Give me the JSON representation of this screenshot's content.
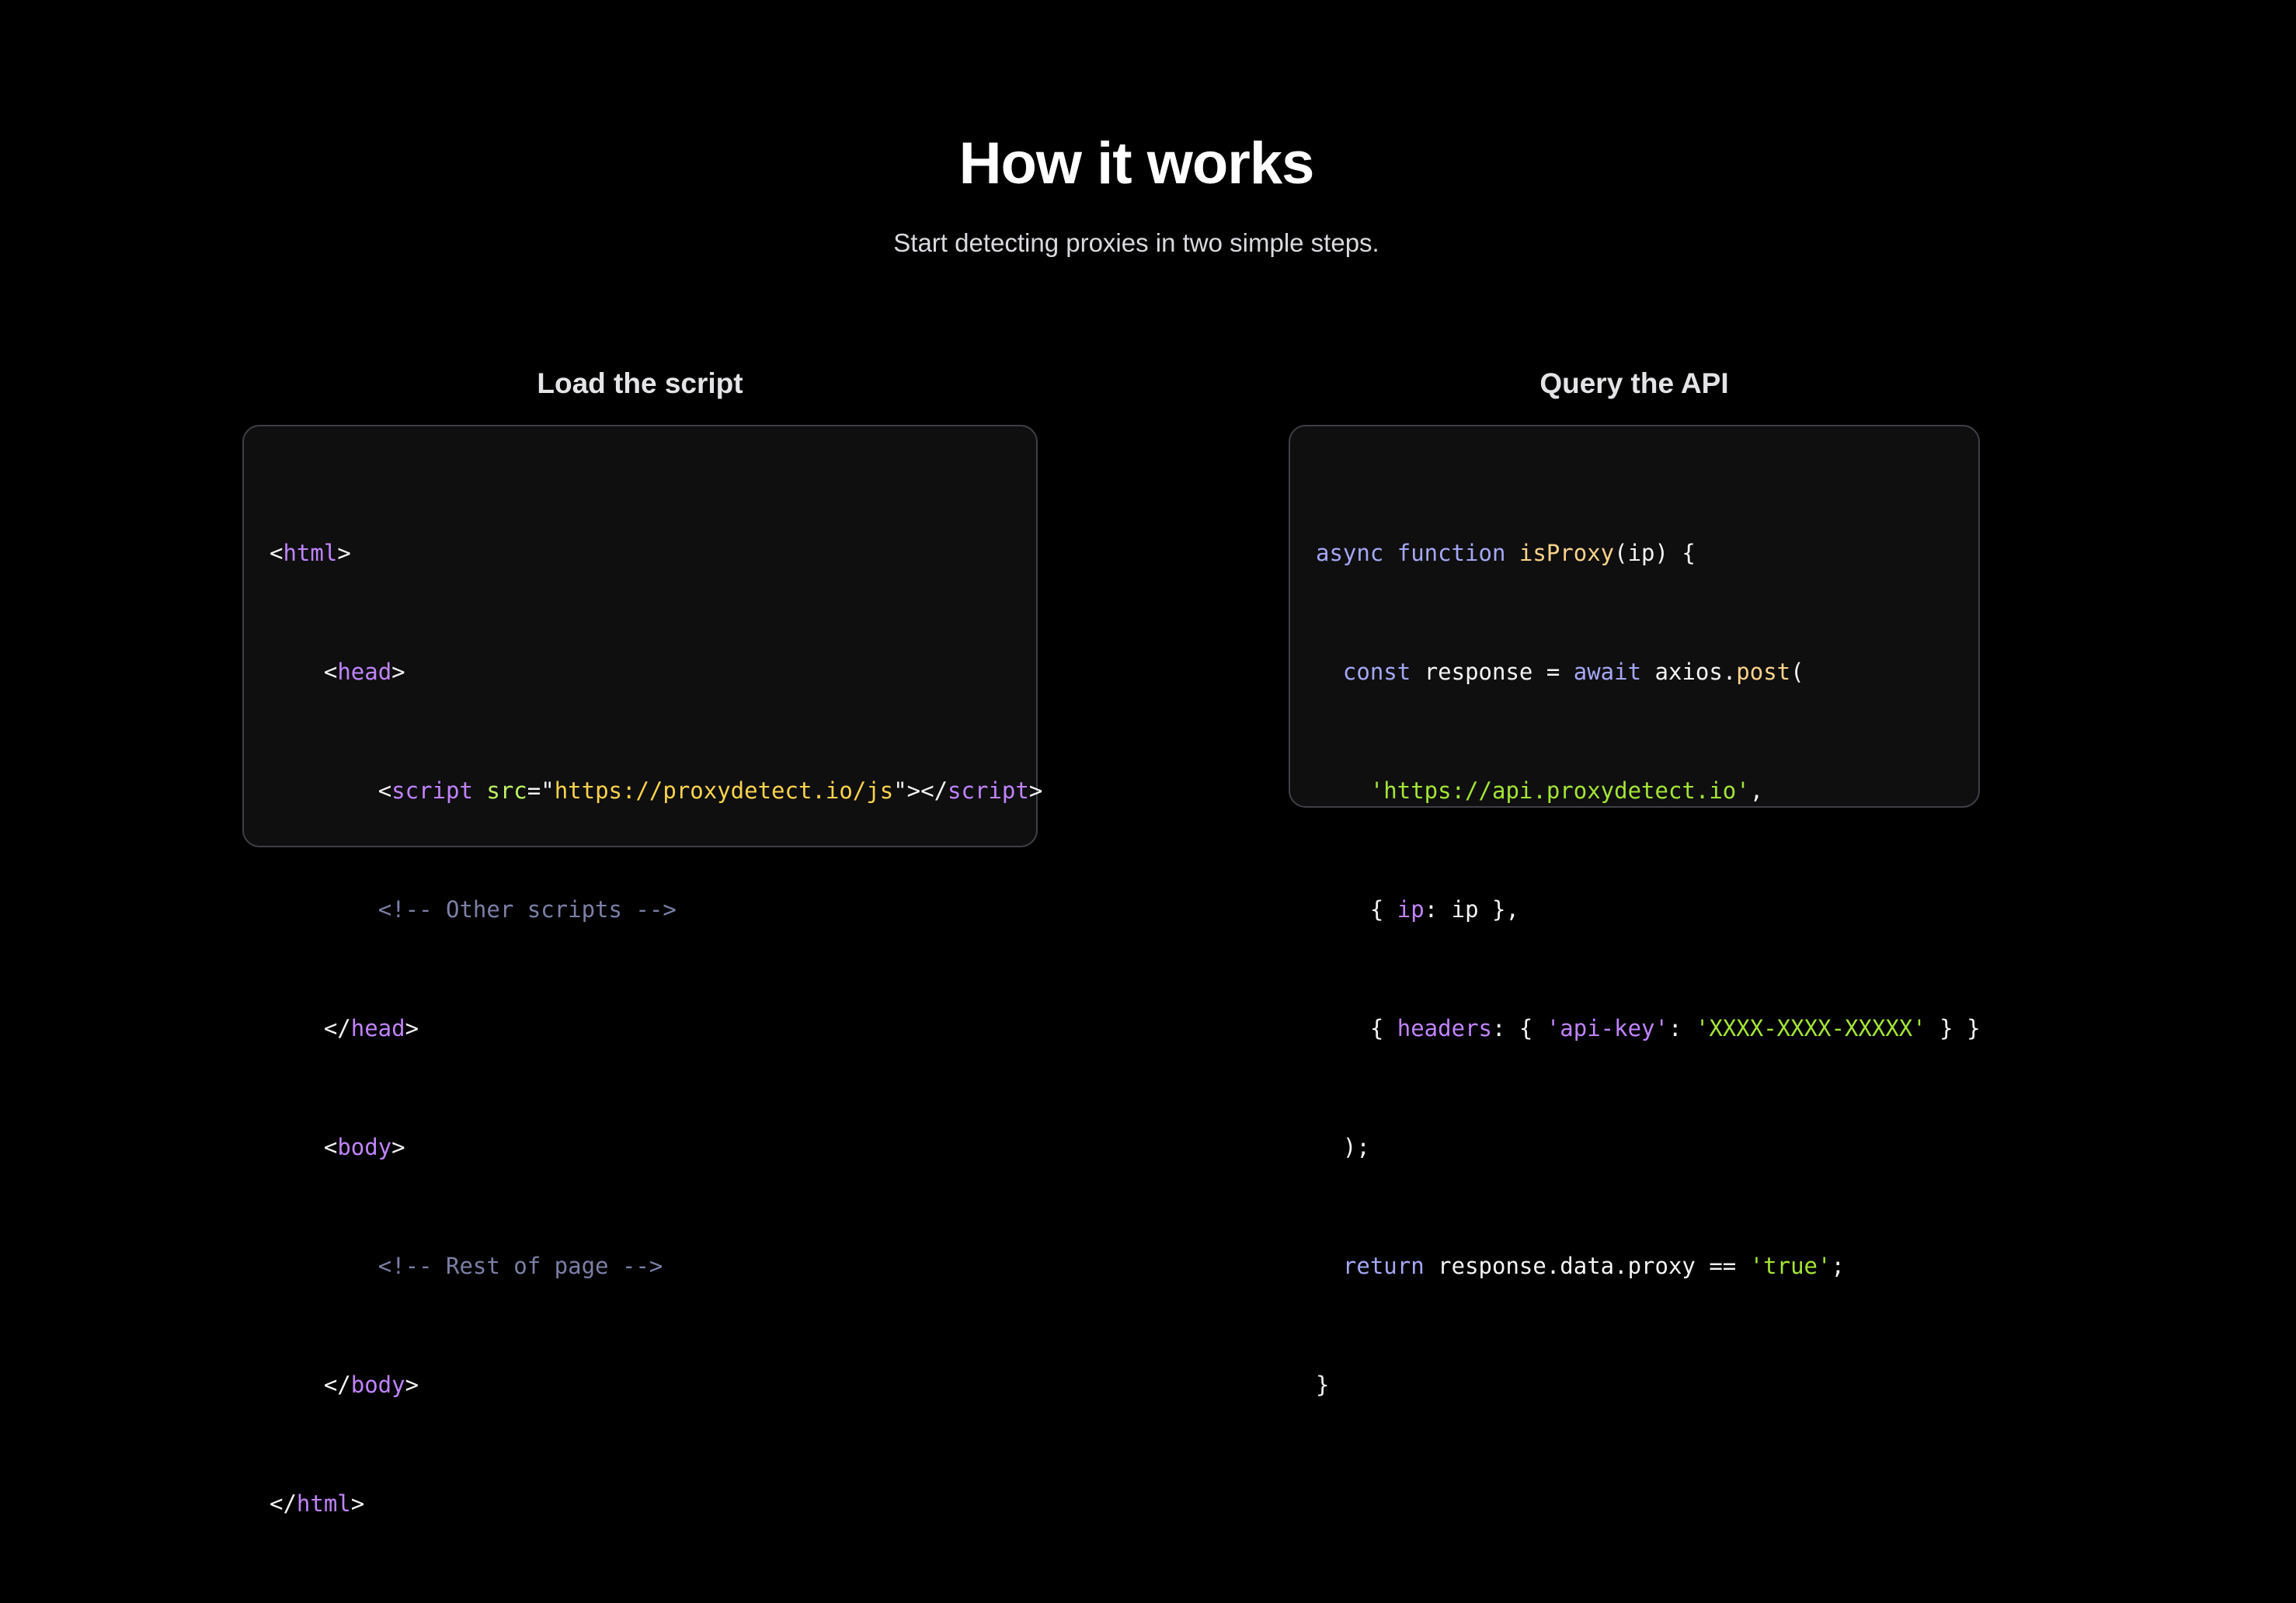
{
  "section": {
    "title": "How it works",
    "subtitle": "Start detecting proxies in two simple steps."
  },
  "steps": [
    {
      "heading": "Load the script",
      "code": {
        "l1_open": "<",
        "l1_tag": "html",
        "l1_close": ">",
        "l2_open": "<",
        "l2_tag": "head",
        "l2_close": ">",
        "l3_open": "<",
        "l3_tag": "script",
        "l3_attr": "src",
        "l3_eq": "=\"",
        "l3_val": "https://proxydetect.io/js",
        "l3_mid": "\"></",
        "l3_tag2": "script",
        "l3_close": ">",
        "l4_comment": "<!-- Other scripts -->",
        "l5_open": "</",
        "l5_tag": "head",
        "l5_close": ">",
        "l6_open": "<",
        "l6_tag": "body",
        "l6_close": ">",
        "l7_comment": "<!-- Rest of page -->",
        "l8_open": "</",
        "l8_tag": "body",
        "l8_close": ">",
        "l9_open": "</",
        "l9_tag": "html",
        "l9_close": ">"
      }
    },
    {
      "heading": "Query the API",
      "code": {
        "l1_kw": "async function",
        "l1_fn": "isProxy",
        "l1_rest": "(ip) {",
        "l2_kw": "const",
        "l2_mid": " response = ",
        "l2_kw2": "await",
        "l2_obj": " axios.",
        "l2_fn": "post",
        "l2_end": "(",
        "l3_str": "'https://api.proxydetect.io'",
        "l3_end": ",",
        "l4_open": "{ ",
        "l4_prop": "ip",
        "l4_rest": ": ip },",
        "l5_open": "{ ",
        "l5_prop": "headers",
        "l5_mid": ": { ",
        "l5_key": "'api-key'",
        "l5_colon": ": ",
        "l5_val": "'XXXX-XXXX-XXXXX'",
        "l5_end": " } }",
        "l6": ");",
        "l7_kw": "return",
        "l7_mid": " response.data.proxy == ",
        "l7_str": "'true'",
        "l7_end": ";",
        "l8": "}"
      }
    }
  ]
}
